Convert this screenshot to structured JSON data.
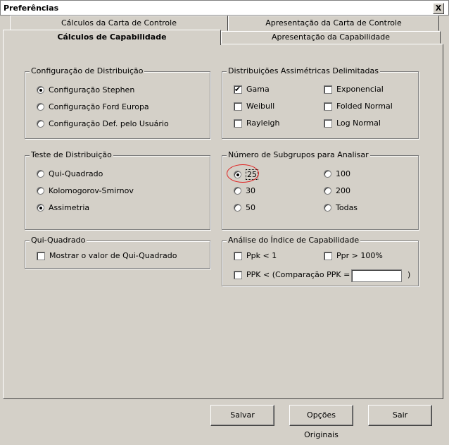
{
  "window": {
    "title": "Preferências",
    "close_label": "X"
  },
  "tabs": {
    "row_back": [
      "Cálculos da Carta de Controle",
      "Apresentação da Carta de Controle"
    ],
    "row_front": [
      "Cálculos de Capabilidade",
      "Apresentação da Capabilidade"
    ],
    "active": "Cálculos de Capabilidade"
  },
  "distribution_config": {
    "title": "Configuração de Distribuição",
    "options": [
      "Configuração Stephen",
      "Configuração Ford Europa",
      "Configuração Def. pelo Usuário"
    ],
    "selected": "Configuração Stephen"
  },
  "asymmetric": {
    "title": "Distribuições Assimétricas Delimitadas",
    "options": [
      "Gama",
      "Exponencial",
      "Weibull",
      "Folded Normal",
      "Rayleigh",
      "Log Normal"
    ],
    "checked": [
      "Gama"
    ]
  },
  "distribution_test": {
    "title": "Teste de Distribuição",
    "options": [
      "Qui-Quadrado",
      "Kolomogorov-Smirnov",
      "Assimetria"
    ],
    "selected": "Assimetria"
  },
  "subgroups": {
    "title": "Número de Subgrupos para Analisar",
    "options": [
      "25",
      "100",
      "30",
      "200",
      "50",
      "Todas"
    ],
    "selected": "25"
  },
  "chi_square": {
    "title": "Qui-Quadrado",
    "option": "Mostrar o valor de Qui-Quadrado"
  },
  "capability_index": {
    "title": "Análise do Índice de Capabilidade",
    "ppk_lt1": "Ppk < 1",
    "ppr_gt100": "Ppr > 100%",
    "ppk_compare": "PPK < (Comparação PPK =",
    "ppk_compare_close": ")",
    "ppk_value": ""
  },
  "buttons": {
    "save": "Salvar",
    "defaults": "Opções Originais",
    "exit": "Sair"
  },
  "colors": {
    "face": "#d4d0c8",
    "highlight_circle": "#e02020"
  }
}
